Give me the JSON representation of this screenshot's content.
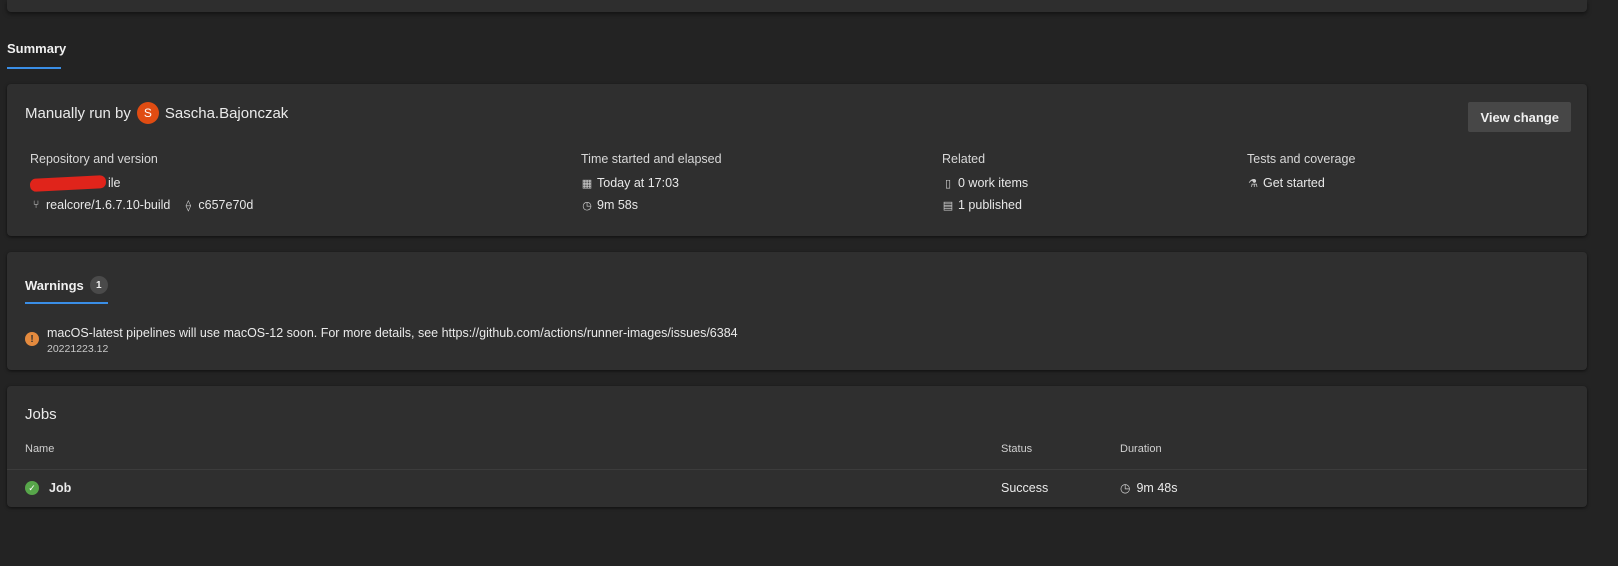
{
  "page_tab": "Summary",
  "summary": {
    "run_prefix": "Manually run by",
    "avatar_initial": "S",
    "user_name": "Sascha.Bajonczak",
    "view_change_label": "View change",
    "repository": {
      "label": "Repository and version",
      "repo_name_visible": "ile",
      "branch": "realcore/1.6.7.10-build",
      "commit": "c657e70d"
    },
    "time": {
      "label": "Time started and elapsed",
      "started": "Today at 17:03",
      "elapsed": "9m 58s"
    },
    "related": {
      "label": "Related",
      "work_items": "0 work items",
      "published": "1 published"
    },
    "tests": {
      "label": "Tests and coverage",
      "link": "Get started"
    }
  },
  "warnings": {
    "tab_label": "Warnings",
    "count": "1",
    "items": [
      {
        "message": "macOS-latest pipelines will use macOS-12 soon. For more details, see https://github.com/actions/runner-images/issues/6384",
        "sub": "20221223.12"
      }
    ]
  },
  "jobs": {
    "title": "Jobs",
    "columns": {
      "name": "Name",
      "status": "Status",
      "duration": "Duration"
    },
    "rows": [
      {
        "name": "Job",
        "status": "Success",
        "duration": "9m 48s"
      }
    ]
  },
  "colors": {
    "accent": "#3a8ee6",
    "link": "#5aa8f0",
    "avatar": "#e04c12",
    "warning": "#e48a3e",
    "success": "#57a64a",
    "redaction": "#e0241b"
  }
}
